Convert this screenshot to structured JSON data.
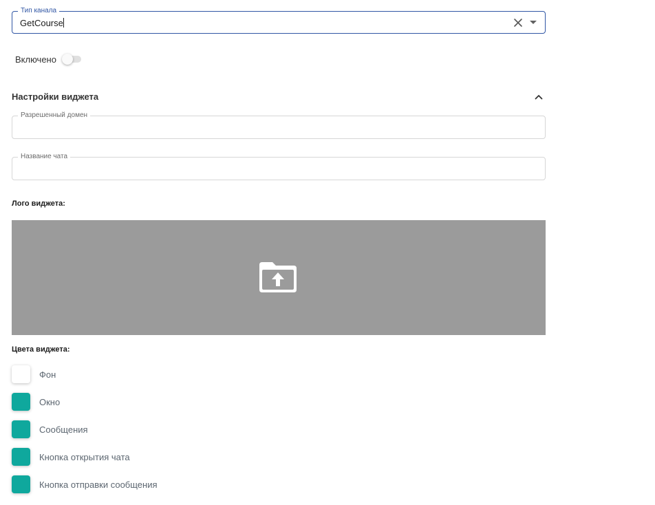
{
  "channel": {
    "legend": "Тип канала",
    "value": "GetCourse",
    "focus_color": "#2f55a4"
  },
  "enabled": {
    "label": "Включено",
    "on": false
  },
  "widget_settings": {
    "title": "Настройки виджета",
    "expanded": true,
    "domain_field": {
      "legend": "Разрешенный домен",
      "value": ""
    },
    "chat_name_field": {
      "legend": "Название чата",
      "value": ""
    },
    "logo": {
      "label": "Лого виджета:",
      "icon": "folder-upload-icon",
      "drop_color": "#9b9b9b"
    },
    "colors": {
      "label": "Цвета виджета:",
      "items": [
        {
          "label": "Фон",
          "color": "#ffffff"
        },
        {
          "label": "Окно",
          "color": "#0fa89d"
        },
        {
          "label": "Сообщения",
          "color": "#0fa89d"
        },
        {
          "label": "Кнопка открытия чата",
          "color": "#0fa89d"
        },
        {
          "label": "Кнопка отправки сообщения",
          "color": "#0fa89d"
        }
      ]
    }
  }
}
